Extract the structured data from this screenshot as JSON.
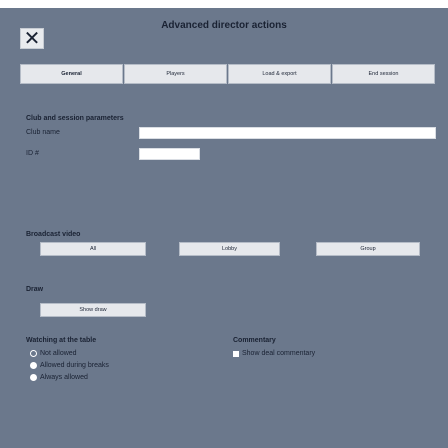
{
  "window": {
    "title": "Advanced director actions",
    "close_glyph": "✕"
  },
  "tabs": [
    "General",
    "Players",
    "Load & export",
    "End session"
  ],
  "club_session": {
    "heading": "Club and session parameters",
    "club_name_label": "Club name",
    "club_name_value": "",
    "id_label": "ID #",
    "id_value": ""
  },
  "broadcast": {
    "heading": "Broadcast video",
    "buttons": [
      "All",
      "Lobby",
      "Group"
    ]
  },
  "draw": {
    "heading": "Draw",
    "button": "Show draw"
  },
  "watching": {
    "heading": "Watching at the table",
    "options": [
      "Not allowed",
      "Allowed during breaks",
      "Always allowed"
    ],
    "selected_index": 0
  },
  "commentary": {
    "heading": "Commentary",
    "checkbox_label": "Show deal commentary",
    "checked": false
  },
  "colors": {
    "background": "#6b788c",
    "button": "#e6e8ec",
    "input": "#ffffff"
  }
}
